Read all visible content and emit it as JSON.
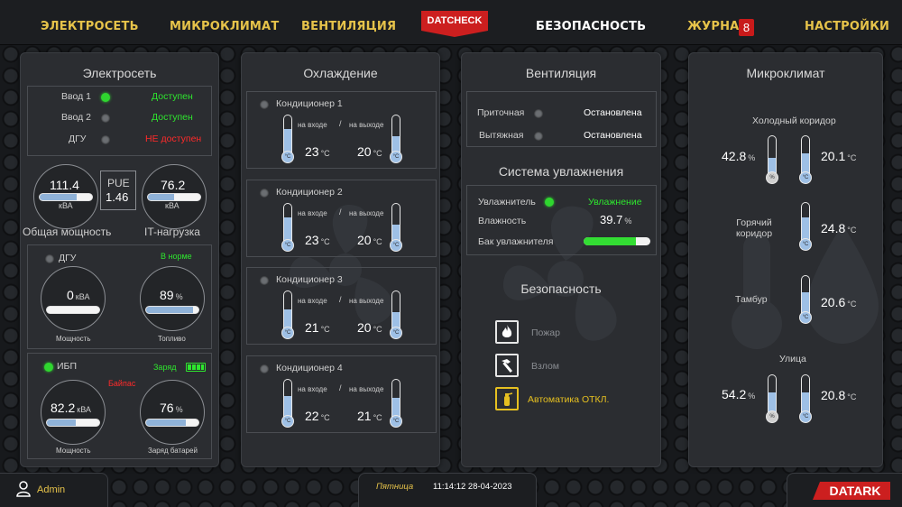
{
  "nav": {
    "items": [
      "ЭЛЕКТРОСЕТЬ",
      "МИКРОКЛИМАТ",
      "ВЕНТИЛЯЦИЯ",
      "БЕЗОПАСНОСТЬ",
      "ЖУРНАЛ",
      "НАСТРОЙКИ"
    ],
    "journal_badge": "8",
    "datcheck": "DATCHECK"
  },
  "power": {
    "title": "Электросеть",
    "inputs": [
      {
        "label": "Ввод 1",
        "status": "Доступен",
        "led": "on"
      },
      {
        "label": "Ввод 2",
        "status": "Доступен",
        "led": "off"
      },
      {
        "label": "ДГУ",
        "status": "НЕ доступен",
        "led": "off"
      }
    ],
    "total": {
      "value": "111.4",
      "unit": "кВА",
      "label": "Общая мощность"
    },
    "pue": {
      "label": "PUE",
      "value": "1.46"
    },
    "it": {
      "value": "76.2",
      "unit": "кВА",
      "label": "IT-нагрузка"
    },
    "dgu": {
      "label": "ДГУ",
      "status": "В норме",
      "power": {
        "value": "0",
        "unit": "кВА",
        "label": "Мощность",
        "fill": 0
      },
      "fuel": {
        "value": "89",
        "unit": "%",
        "label": "Топливо",
        "fill": 0.89
      }
    },
    "ups": {
      "label": "ИБП",
      "charge_label": "Заряд",
      "bypass": "Байпас",
      "power": {
        "value": "82.2",
        "unit": "кВА",
        "label": "Мощность",
        "fill": 0.55
      },
      "battery": {
        "value": "76",
        "unit": "%",
        "label": "Заряд батарей",
        "fill": 0.76
      }
    }
  },
  "cooling": {
    "title": "Охлаждение",
    "in_label": "на входе",
    "out_label": "на выходе",
    "sep": "/",
    "unit": "°С",
    "units": [
      {
        "name": "Кондиционер 1",
        "in": "23",
        "out": "20"
      },
      {
        "name": "Кондиционер 2",
        "in": "23",
        "out": "20"
      },
      {
        "name": "Кондиционер 3",
        "in": "21",
        "out": "20"
      },
      {
        "name": "Кондиционер 4",
        "in": "22",
        "out": "21"
      }
    ]
  },
  "ventilation": {
    "title": "Вентиляция",
    "rows": [
      {
        "label": "Приточная",
        "status": "Остановлена"
      },
      {
        "label": "Вытяжная",
        "status": "Остановлена"
      }
    ],
    "humid_title": "Система увлажнения",
    "humidifier": {
      "label": "Увлажнитель",
      "status": "Увлажнение"
    },
    "humidity": {
      "label": "Влажность",
      "value": "39.7",
      "unit": "%"
    },
    "tank": {
      "label": "Бак увлажнителя",
      "fill": 0.78
    },
    "security_title": "Безопасность",
    "security": [
      {
        "label": "Пожар",
        "icon": "fire-icon"
      },
      {
        "label": "Взлом",
        "icon": "hammer-icon"
      },
      {
        "label": "Автоматика ОТКЛ.",
        "icon": "extinguisher-icon"
      }
    ]
  },
  "climate": {
    "title": "Микроклимат",
    "cold": {
      "label": "Холодный коридор",
      "humidity": "42.8",
      "temp": "20.1"
    },
    "hot": {
      "label": "Горячий коридор",
      "temp": "24.8"
    },
    "tambur": {
      "label": "Тамбур",
      "temp": "20.6"
    },
    "street": {
      "label": "Улица",
      "humidity": "54.2",
      "temp": "20.8"
    },
    "pct": "%",
    "deg": "°С"
  },
  "footer": {
    "user": "Admin",
    "day": "Пятница",
    "datetime": "11:14:12 28-04-2023",
    "brand": "DATARK"
  },
  "colors": {
    "accent": "#e6c34a",
    "red": "#cc1f1f",
    "ok": "#2ee62e",
    "bar": "#8fb2d8"
  }
}
